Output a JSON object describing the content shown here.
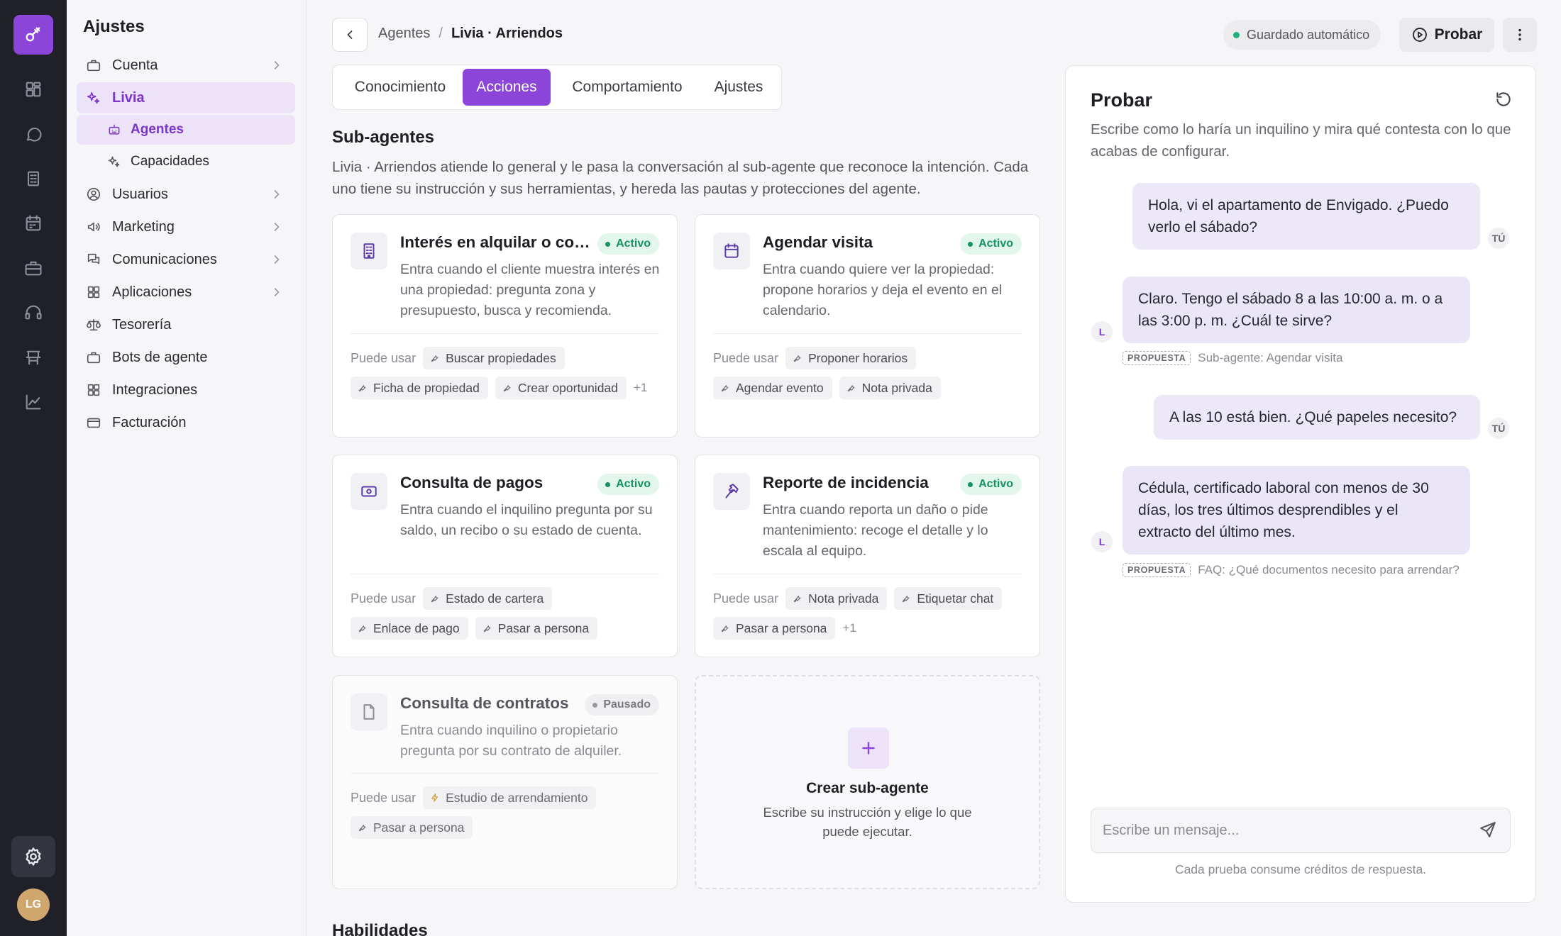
{
  "colors": {
    "accent": "#8b45d8",
    "active_green": "#15925f",
    "rail_bg": "#202029"
  },
  "rail": {
    "logo_icon": "key-icon",
    "items": [
      "dashboard-icon",
      "chat-icon",
      "building-icon",
      "calendar-icon",
      "briefcase-icon",
      "headset-icon",
      "store-icon",
      "chart-icon"
    ],
    "settings_icon": "gear-icon",
    "avatar": "LG"
  },
  "sidebar": {
    "title": "Ajustes",
    "items": [
      {
        "label": "Cuenta",
        "icon": "briefcase-icon"
      },
      {
        "label": "Livia",
        "icon": "sparkle-icon"
      },
      {
        "label": "Agentes",
        "icon": "bot-icon"
      },
      {
        "label": "Capacidades",
        "icon": "sparkle-icon"
      },
      {
        "label": "Usuarios",
        "icon": "user-circle-icon"
      },
      {
        "label": "Marketing",
        "icon": "megaphone-icon"
      },
      {
        "label": "Comunicaciones",
        "icon": "messages-icon"
      },
      {
        "label": "Aplicaciones",
        "icon": "grid-icon"
      },
      {
        "label": "Tesorería",
        "icon": "scale-icon"
      },
      {
        "label": "Bots de agente",
        "icon": "bot-icon"
      },
      {
        "label": "Integraciones",
        "icon": "grid-icon"
      },
      {
        "label": "Facturación",
        "icon": "credit-card-icon"
      }
    ]
  },
  "header": {
    "breadcrumb_parent": "Agentes",
    "breadcrumb_sep": "/",
    "breadcrumb_current": "Livia · Arriendos",
    "autosave": "Guardado automático",
    "probar": "Probar"
  },
  "tabs": [
    "Conocimiento",
    "Acciones",
    "Comportamiento",
    "Ajustes"
  ],
  "subagents": {
    "title": "Sub-agentes",
    "description": "Livia · Arriendos atiende lo general y le pasa la conversación al sub-agente que reconoce la intención. Cada uno tiene su instrucción y sus herramientas, y hereda las pautas y protecciones del agente.",
    "tools_label": "Puede usar",
    "cards": [
      {
        "title": "Interés en alquilar o comprar",
        "status": "Activo",
        "description": "Entra cuando el cliente muestra interés en una propiedad: pregunta zona y presupuesto, busca y recomienda.",
        "tools": [
          "Buscar propiedades",
          "Ficha de propiedad",
          "Crear oportunidad"
        ],
        "more": "+1"
      },
      {
        "title": "Agendar visita",
        "status": "Activo",
        "description": "Entra cuando quiere ver la propiedad: propone horarios y deja el evento en el calendario.",
        "tools": [
          "Proponer horarios",
          "Agendar evento",
          "Nota privada"
        ],
        "more": ""
      },
      {
        "title": "Consulta de pagos",
        "status": "Activo",
        "description": "Entra cuando el inquilino pregunta por su saldo, un recibo o su estado de cuenta.",
        "tools": [
          "Estado de cartera",
          "Enlace de pago",
          "Pasar a persona"
        ],
        "more": ""
      },
      {
        "title": "Reporte de incidencia",
        "status": "Activo",
        "description": "Entra cuando reporta un daño o pide mantenimiento: recoge el detalle y lo escala al equipo.",
        "tools": [
          "Nota privada",
          "Etiquetar chat",
          "Pasar a persona"
        ],
        "more": "+1"
      },
      {
        "title": "Consulta de contratos",
        "status": "Pausado",
        "description": "Entra cuando inquilino o propietario pregunta por su contrato de alquiler.",
        "tools": [
          "Estudio de arrendamiento",
          "Pasar a persona"
        ],
        "more": ""
      }
    ],
    "create": {
      "title": "Crear sub-agente",
      "description": "Escribe su instrucción y elige lo que puede ejecutar."
    }
  },
  "habilidades": "Habilidades",
  "test_panel": {
    "title": "Probar",
    "description": "Escribe como lo haría un inquilino y mira qué contesta con lo que acabas de configurar.",
    "messages": [
      {
        "from": "user",
        "text": "Hola, vi el apartamento de Envigado. ¿Puedo verlo el sábado?",
        "avatar": "TÚ"
      },
      {
        "from": "bot",
        "text": "Claro. Tengo el sábado 8 a las 10:00 a. m. o a las 3:00 p. m. ¿Cuál te sirve?",
        "avatar": "L",
        "proposal_tag": "PROPUESTA",
        "proposal": "Sub-agente: Agendar visita"
      },
      {
        "from": "user",
        "text": "A las 10 está bien. ¿Qué papeles necesito?",
        "avatar": "TÚ"
      },
      {
        "from": "bot",
        "text": "Cédula, certificado laboral con menos de 30 días, los tres últimos desprendibles y el extracto del último mes.",
        "avatar": "L",
        "proposal_tag": "PROPUESTA",
        "proposal": "FAQ: ¿Qué documentos necesito para arrendar?"
      }
    ],
    "input_placeholder": "Escribe un mensaje...",
    "footer": "Cada prueba consume créditos de respuesta."
  }
}
